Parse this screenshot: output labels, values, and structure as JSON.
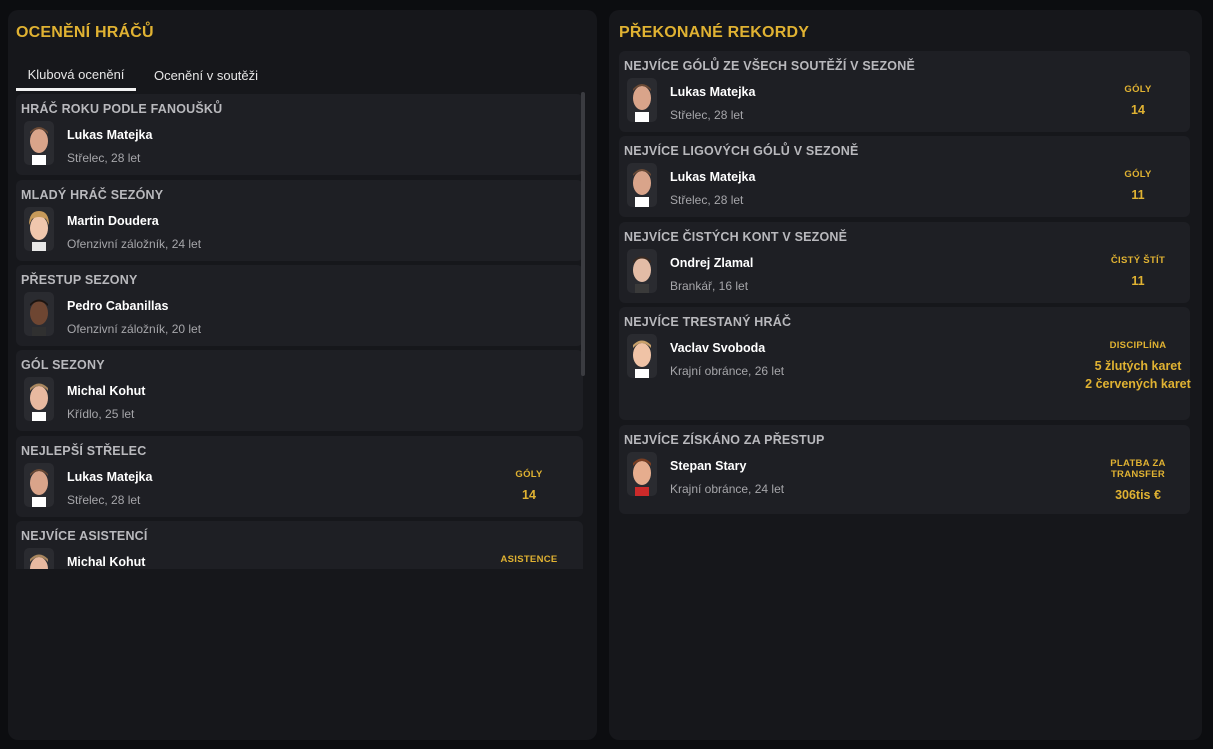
{
  "left": {
    "title": "OCENĚNÍ HRÁČŮ",
    "tabs": [
      "Klubová ocenění",
      "Ocenění v soutěži"
    ],
    "cards": [
      {
        "title": "HRÁČ ROKU PODLE FANOUŠKŮ",
        "name": "Lukas Matejka",
        "info": "Střelec, 28 let",
        "stat_label": "",
        "stat_value": ""
      },
      {
        "title": "MLADÝ HRÁČ SEZÓNY",
        "name": "Martin Doudera",
        "info": "Ofenzivní záložník, 24 let",
        "stat_label": "",
        "stat_value": ""
      },
      {
        "title": "PŘESTUP SEZONY",
        "name": "Pedro Cabanillas",
        "info": "Ofenzivní záložník, 20 let",
        "stat_label": "",
        "stat_value": ""
      },
      {
        "title": "GÓL SEZONY",
        "name": "Michal Kohut",
        "info": "Křídlo, 25 let",
        "stat_label": "",
        "stat_value": ""
      },
      {
        "title": "NEJLEPŠÍ STŘELEC",
        "name": "Lukas Matejka",
        "info": "Střelec, 28 let",
        "stat_label": "GÓLY",
        "stat_value": "14"
      },
      {
        "title": "NEJVÍCE ASISTENCÍ",
        "name": "Michal Kohut",
        "info": "",
        "stat_label": "ASISTENCE",
        "stat_value": ""
      }
    ]
  },
  "right": {
    "title": "PŘEKONANÉ REKORDY",
    "cards": [
      {
        "title": "NEJVÍCE GÓLŮ ZE VŠECH SOUTĚŽÍ V SEZONĚ",
        "name": "Lukas Matejka",
        "info": "Střelec, 28 let",
        "stat_label": "GÓLY",
        "stat_value": "14"
      },
      {
        "title": "NEJVÍCE LIGOVÝCH GÓLŮ V SEZONĚ",
        "name": "Lukas Matejka",
        "info": "Střelec, 28 let",
        "stat_label": "GÓLY",
        "stat_value": "11"
      },
      {
        "title": "NEJVÍCE ČISTÝCH KONT V SEZONĚ",
        "name": "Ondrej Zlamal",
        "info": "Brankář, 16 let",
        "stat_label": "ČISTÝ ŠTÍT",
        "stat_value": "11"
      },
      {
        "title": "NEJVÍCE TRESTANÝ HRÁČ",
        "name": "Vaclav Svoboda",
        "info": "Krajní obránce, 26 let",
        "stat_label": "DISCIPLÍNA",
        "stat_value": "5 žlutých karet\n2 červených karet"
      },
      {
        "title": "NEJVÍCE ZÍSKÁNO ZA PŘESTUP",
        "name": "Stepan Stary",
        "info": "Krajní obránce, 24 let",
        "stat_label": "PLATBA ZA TRANSFER",
        "stat_value": "306tis €"
      }
    ]
  },
  "colors": {
    "accent": "#e0b232",
    "panel": "#16171b",
    "card": "#1e1f24"
  }
}
